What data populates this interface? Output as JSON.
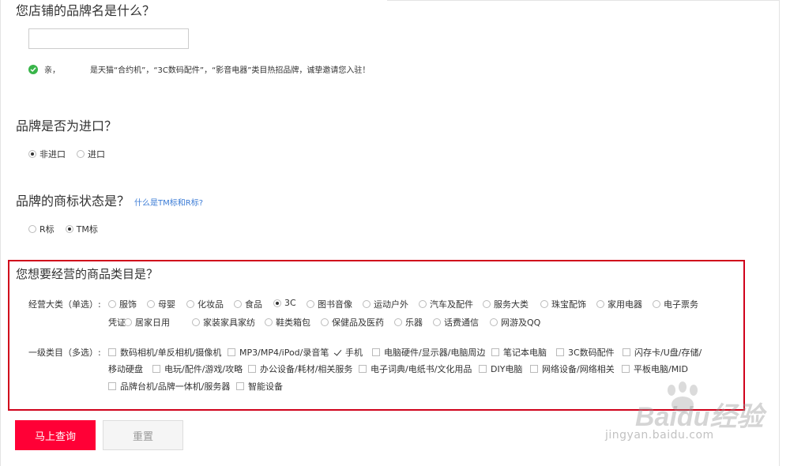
{
  "brand_name_question": "您店铺的品牌名是什么？",
  "brand_name_input_value": "",
  "brand_tip": {
    "prefix": "亲，",
    "text": "是天猫“合约机”，“3C数码配件”，“影音电器”类目热招品牌，诚挚邀请您入驻！"
  },
  "import_question": "品牌是否为进口？",
  "import_options": [
    "非进口",
    "进口"
  ],
  "import_selected": "非进口",
  "trademark_question": "品牌的商标状态是？",
  "trademark_link": "什么是TM标和R标?",
  "trademark_options": [
    "R标",
    "TM标"
  ],
  "trademark_selected": "TM标",
  "category_title": "您想要经营的商品类目是？",
  "main_category_label": "经营大类（单选）:",
  "main_categories": [
    "服饰",
    "母婴",
    "化妆品",
    "食品",
    "3C",
    "图书音像",
    "运动户外",
    "汽车及配件",
    "服务大类",
    "珠宝配饰",
    "家用电器",
    "电子票务凭证",
    "居家日用",
    "家装家具家纺",
    "鞋类箱包",
    "保健品及医药",
    "乐器",
    "话费通信",
    "网游及QQ"
  ],
  "main_category_selected": "3C",
  "sub_category_label": "一级类目（多选）:",
  "sub_categories": [
    "数码相机/单反相机/摄像机",
    "MP3/MP4/iPod/录音笔",
    "手机",
    "电脑硬件/显示器/电脑周边",
    "笔记本电脑",
    "3C数码配件",
    "闪存卡/U盘/存储/移动硬盘",
    "电玩/配件/游戏/攻略",
    "办公设备/耗材/相关服务",
    "电子词典/电纸书/文化用品",
    "DIY电脑",
    "网络设备/网络相关",
    "平板电脑/MID",
    "品牌台机/品牌一体机/服务器",
    "智能设备"
  ],
  "sub_category_checked": [
    "手机"
  ],
  "search_button": "马上查询",
  "reset_button": "重置",
  "watermark": {
    "brand": "Baidu经验",
    "url": "jingyan.baidu.com"
  },
  "colors": {
    "primary": "#ff0036",
    "highlight_border": "#d0021b",
    "success": "#39b54a",
    "link": "#3a7bd5"
  }
}
